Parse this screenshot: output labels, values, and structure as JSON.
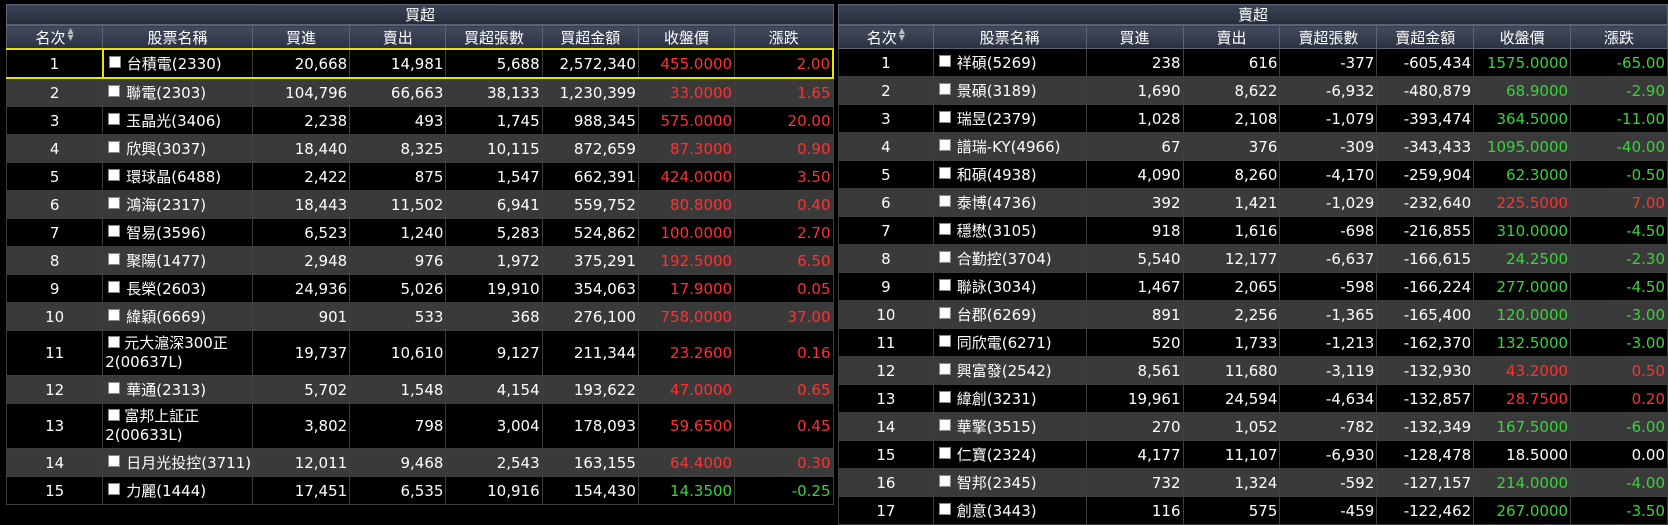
{
  "colors": {
    "up": "#ff3131",
    "down": "#39d439",
    "highlight": "#e6e600"
  },
  "buy": {
    "title": "買超",
    "headers": [
      "名次",
      "股票名稱",
      "買進",
      "賣出",
      "買超張數",
      "買超金額",
      "收盤價",
      "漲跌"
    ],
    "rows": [
      {
        "rank": "1",
        "name": "台積電(2330)",
        "buy": "20,668",
        "sell": "14,981",
        "net": "5,688",
        "amount": "2,572,340",
        "close": "455.0000",
        "change": "2.00",
        "dir": "up"
      },
      {
        "rank": "2",
        "name": "聯電(2303)",
        "buy": "104,796",
        "sell": "66,663",
        "net": "38,133",
        "amount": "1,230,399",
        "close": "33.0000",
        "change": "1.65",
        "dir": "up"
      },
      {
        "rank": "3",
        "name": "玉晶光(3406)",
        "buy": "2,238",
        "sell": "493",
        "net": "1,745",
        "amount": "988,345",
        "close": "575.0000",
        "change": "20.00",
        "dir": "up"
      },
      {
        "rank": "4",
        "name": "欣興(3037)",
        "buy": "18,440",
        "sell": "8,325",
        "net": "10,115",
        "amount": "872,659",
        "close": "87.3000",
        "change": "0.90",
        "dir": "up"
      },
      {
        "rank": "5",
        "name": "環球晶(6488)",
        "buy": "2,422",
        "sell": "875",
        "net": "1,547",
        "amount": "662,391",
        "close": "424.0000",
        "change": "3.50",
        "dir": "up"
      },
      {
        "rank": "6",
        "name": "鴻海(2317)",
        "buy": "18,443",
        "sell": "11,502",
        "net": "6,941",
        "amount": "559,752",
        "close": "80.8000",
        "change": "0.40",
        "dir": "up"
      },
      {
        "rank": "7",
        "name": "智易(3596)",
        "buy": "6,523",
        "sell": "1,240",
        "net": "5,283",
        "amount": "524,862",
        "close": "100.0000",
        "change": "2.70",
        "dir": "up"
      },
      {
        "rank": "8",
        "name": "聚陽(1477)",
        "buy": "2,948",
        "sell": "976",
        "net": "1,972",
        "amount": "375,291",
        "close": "192.5000",
        "change": "6.50",
        "dir": "up"
      },
      {
        "rank": "9",
        "name": "長榮(2603)",
        "buy": "24,936",
        "sell": "5,026",
        "net": "19,910",
        "amount": "354,063",
        "close": "17.9000",
        "change": "0.05",
        "dir": "up"
      },
      {
        "rank": "10",
        "name": "緯穎(6669)",
        "buy": "901",
        "sell": "533",
        "net": "368",
        "amount": "276,100",
        "close": "758.0000",
        "change": "37.00",
        "dir": "up"
      },
      {
        "rank": "11",
        "name": "元大滬深300正2(00637L)",
        "buy": "19,737",
        "sell": "10,610",
        "net": "9,127",
        "amount": "211,344",
        "close": "23.2600",
        "change": "0.16",
        "dir": "up",
        "tall": true
      },
      {
        "rank": "12",
        "name": "華通(2313)",
        "buy": "5,702",
        "sell": "1,548",
        "net": "4,154",
        "amount": "193,622",
        "close": "47.0000",
        "change": "0.65",
        "dir": "up"
      },
      {
        "rank": "13",
        "name": "富邦上証正2(00633L)",
        "buy": "3,802",
        "sell": "798",
        "net": "3,004",
        "amount": "178,093",
        "close": "59.6500",
        "change": "0.45",
        "dir": "up",
        "tall": true
      },
      {
        "rank": "14",
        "name": "日月光投控(3711)",
        "buy": "12,011",
        "sell": "9,468",
        "net": "2,543",
        "amount": "163,155",
        "close": "64.4000",
        "change": "0.30",
        "dir": "up"
      },
      {
        "rank": "15",
        "name": "力麗(1444)",
        "buy": "17,451",
        "sell": "6,535",
        "net": "10,916",
        "amount": "154,430",
        "close": "14.3500",
        "change": "-0.25",
        "dir": "down"
      }
    ]
  },
  "sell": {
    "title": "賣超",
    "headers": [
      "名次",
      "股票名稱",
      "買進",
      "賣出",
      "賣超張數",
      "賣超金額",
      "收盤價",
      "漲跌"
    ],
    "rows": [
      {
        "rank": "1",
        "name": "祥碩(5269)",
        "buy": "238",
        "sell": "616",
        "net": "-377",
        "amount": "-605,434",
        "close": "1575.0000",
        "change": "-65.00",
        "dir": "down"
      },
      {
        "rank": "2",
        "name": "景碩(3189)",
        "buy": "1,690",
        "sell": "8,622",
        "net": "-6,932",
        "amount": "-480,879",
        "close": "68.9000",
        "change": "-2.90",
        "dir": "down"
      },
      {
        "rank": "3",
        "name": "瑞昱(2379)",
        "buy": "1,028",
        "sell": "2,108",
        "net": "-1,079",
        "amount": "-393,474",
        "close": "364.5000",
        "change": "-11.00",
        "dir": "down"
      },
      {
        "rank": "4",
        "name": "譜瑞-KY(4966)",
        "buy": "67",
        "sell": "376",
        "net": "-309",
        "amount": "-343,433",
        "close": "1095.0000",
        "change": "-40.00",
        "dir": "down"
      },
      {
        "rank": "5",
        "name": "和碩(4938)",
        "buy": "4,090",
        "sell": "8,260",
        "net": "-4,170",
        "amount": "-259,904",
        "close": "62.3000",
        "change": "-0.50",
        "dir": "down"
      },
      {
        "rank": "6",
        "name": "泰博(4736)",
        "buy": "392",
        "sell": "1,421",
        "net": "-1,029",
        "amount": "-232,640",
        "close": "225.5000",
        "change": "7.00",
        "dir": "up"
      },
      {
        "rank": "7",
        "name": "穩懋(3105)",
        "buy": "918",
        "sell": "1,616",
        "net": "-698",
        "amount": "-216,855",
        "close": "310.0000",
        "change": "-4.50",
        "dir": "down"
      },
      {
        "rank": "8",
        "name": "合勤控(3704)",
        "buy": "5,540",
        "sell": "12,177",
        "net": "-6,637",
        "amount": "-166,615",
        "close": "24.2500",
        "change": "-2.30",
        "dir": "down"
      },
      {
        "rank": "9",
        "name": "聯詠(3034)",
        "buy": "1,467",
        "sell": "2,065",
        "net": "-598",
        "amount": "-166,224",
        "close": "277.0000",
        "change": "-4.50",
        "dir": "down"
      },
      {
        "rank": "10",
        "name": "台郡(6269)",
        "buy": "891",
        "sell": "2,256",
        "net": "-1,365",
        "amount": "-165,400",
        "close": "120.0000",
        "change": "-3.00",
        "dir": "down"
      },
      {
        "rank": "11",
        "name": "同欣電(6271)",
        "buy": "520",
        "sell": "1,733",
        "net": "-1,213",
        "amount": "-162,370",
        "close": "132.5000",
        "change": "-3.00",
        "dir": "down"
      },
      {
        "rank": "12",
        "name": "興富發(2542)",
        "buy": "8,561",
        "sell": "11,680",
        "net": "-3,119",
        "amount": "-132,930",
        "close": "43.2000",
        "change": "0.50",
        "dir": "up"
      },
      {
        "rank": "13",
        "name": "緯創(3231)",
        "buy": "19,961",
        "sell": "24,594",
        "net": "-4,634",
        "amount": "-132,857",
        "close": "28.7500",
        "change": "0.20",
        "dir": "up"
      },
      {
        "rank": "14",
        "name": "華擎(3515)",
        "buy": "270",
        "sell": "1,052",
        "net": "-782",
        "amount": "-132,349",
        "close": "167.5000",
        "change": "-6.00",
        "dir": "down"
      },
      {
        "rank": "15",
        "name": "仁寶(2324)",
        "buy": "4,177",
        "sell": "11,107",
        "net": "-6,930",
        "amount": "-128,478",
        "close": "18.5000",
        "change": "0.00",
        "dir": "flat"
      },
      {
        "rank": "16",
        "name": "智邦(2345)",
        "buy": "732",
        "sell": "1,324",
        "net": "-592",
        "amount": "-127,157",
        "close": "214.0000",
        "change": "-4.00",
        "dir": "down"
      },
      {
        "rank": "17",
        "name": "創意(3443)",
        "buy": "116",
        "sell": "575",
        "net": "-459",
        "amount": "-122,462",
        "close": "267.0000",
        "change": "-3.50",
        "dir": "down"
      }
    ]
  }
}
